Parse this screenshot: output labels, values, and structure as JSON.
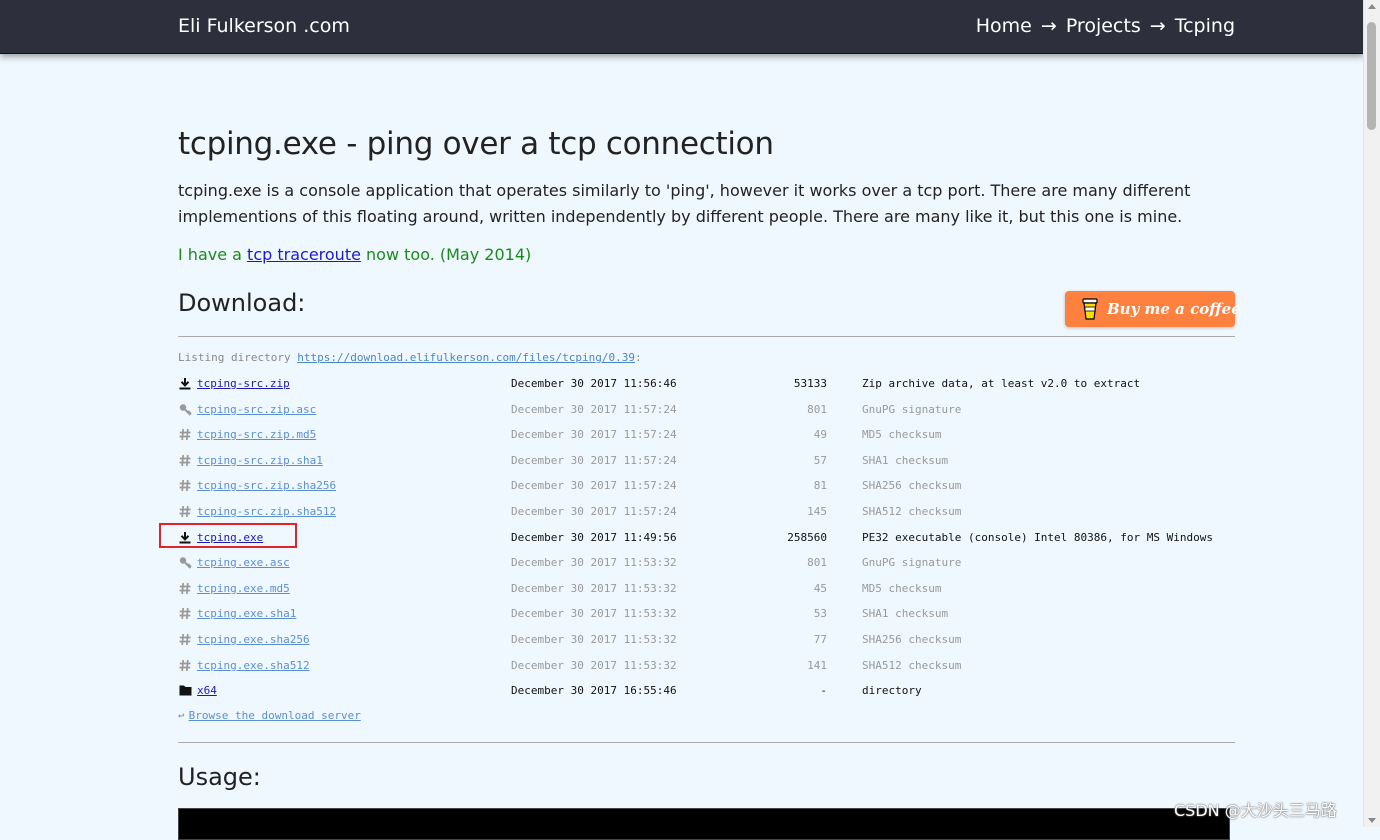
{
  "header": {
    "site_title": "Eli Fulkerson .com",
    "breadcrumb": {
      "home": "Home",
      "projects": "Projects",
      "current": "Tcping",
      "separator": "→"
    }
  },
  "page": {
    "title": "tcping.exe - ping over a tcp connection",
    "intro": "tcping.exe is a console application that operates similarly to 'ping', however it works over a tcp port. There are many different implementions of this floating around, written independently by different people. There are many like it, but this one is mine.",
    "note_prefix": "I have a ",
    "note_link": "tcp traceroute",
    "note_suffix": " now too. (May 2014)"
  },
  "download": {
    "title": "Download:",
    "coffee_label": "Buy me a coffee",
    "listing_prefix": "Listing directory ",
    "listing_url": "https://download.elifulkerson.com/files/tcping/0.39",
    "listing_suffix": ":",
    "files": [
      {
        "icon": "download-icon",
        "name": "tcping-src.zip",
        "date": "December 30 2017 11:56:46",
        "size": "53133",
        "desc": "Zip archive data, at least v2.0 to extract",
        "style": "primary"
      },
      {
        "icon": "key-icon",
        "name": "tcping-src.zip.asc",
        "date": "December 30 2017 11:57:24",
        "size": "801",
        "desc": "GnuPG signature",
        "style": "secondary"
      },
      {
        "icon": "hash-icon",
        "name": "tcping-src.zip.md5",
        "date": "December 30 2017 11:57:24",
        "size": "49",
        "desc": "MD5 checksum",
        "style": "secondary"
      },
      {
        "icon": "hash-icon",
        "name": "tcping-src.zip.sha1",
        "date": "December 30 2017 11:57:24",
        "size": "57",
        "desc": "SHA1 checksum",
        "style": "secondary"
      },
      {
        "icon": "hash-icon",
        "name": "tcping-src.zip.sha256",
        "date": "December 30 2017 11:57:24",
        "size": "81",
        "desc": "SHA256 checksum",
        "style": "secondary"
      },
      {
        "icon": "hash-icon",
        "name": "tcping-src.zip.sha512",
        "date": "December 30 2017 11:57:24",
        "size": "145",
        "desc": "SHA512 checksum",
        "style": "secondary"
      },
      {
        "icon": "download-icon",
        "name": "tcping.exe",
        "date": "December 30 2017 11:49:56",
        "size": "258560",
        "desc": "PE32 executable (console) Intel 80386, for MS Windows",
        "style": "primary"
      },
      {
        "icon": "key-icon",
        "name": "tcping.exe.asc",
        "date": "December 30 2017 11:53:32",
        "size": "801",
        "desc": "GnuPG signature",
        "style": "secondary"
      },
      {
        "icon": "hash-icon",
        "name": "tcping.exe.md5",
        "date": "December 30 2017 11:53:32",
        "size": "45",
        "desc": "MD5 checksum",
        "style": "secondary"
      },
      {
        "icon": "hash-icon",
        "name": "tcping.exe.sha1",
        "date": "December 30 2017 11:53:32",
        "size": "53",
        "desc": "SHA1 checksum",
        "style": "secondary"
      },
      {
        "icon": "hash-icon",
        "name": "tcping.exe.sha256",
        "date": "December 30 2017 11:53:32",
        "size": "77",
        "desc": "SHA256 checksum",
        "style": "secondary"
      },
      {
        "icon": "hash-icon",
        "name": "tcping.exe.sha512",
        "date": "December 30 2017 11:53:32",
        "size": "141",
        "desc": "SHA512 checksum",
        "style": "secondary"
      },
      {
        "icon": "folder-icon",
        "name": "x64",
        "date": "December 30 2017 16:55:46",
        "size": "-",
        "desc": "directory",
        "style": "primary"
      }
    ],
    "browse_arrow": "↩",
    "browse_label": "Browse the download server"
  },
  "usage": {
    "title": "Usage:"
  },
  "watermark": "CSDN @大沙头三马路"
}
